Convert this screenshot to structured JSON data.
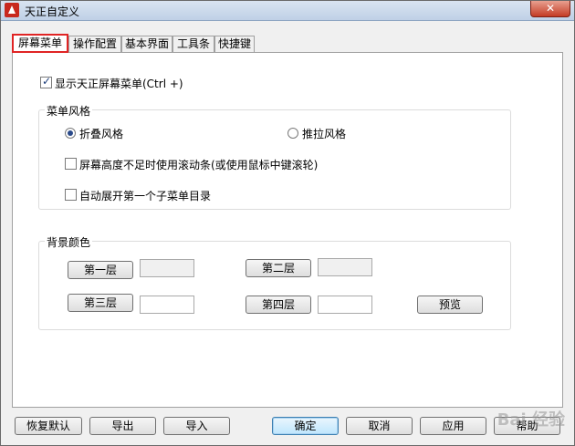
{
  "window": {
    "title": "天正自定义",
    "close_label": "✕"
  },
  "tabs": [
    {
      "label": "屏幕菜单",
      "active": true
    },
    {
      "label": "操作配置",
      "active": false
    },
    {
      "label": "基本界面",
      "active": false
    },
    {
      "label": "工具条",
      "active": false
    },
    {
      "label": "快捷键",
      "active": false
    }
  ],
  "show_menu": {
    "label": "显示天正屏幕菜单(Ctrl +)",
    "checked": true
  },
  "menu_style": {
    "title": "菜单风格",
    "options": [
      {
        "label": "折叠风格",
        "selected": true
      },
      {
        "label": "推拉风格",
        "selected": false
      }
    ],
    "scroll": {
      "label": "屏幕高度不足时使用滚动条(或使用鼠标中键滚轮)",
      "checked": false
    },
    "expand": {
      "label": "自动展开第一个子菜单目录",
      "checked": false
    }
  },
  "bg_color": {
    "title": "背景颜色",
    "layers": [
      {
        "label": "第一层",
        "color": "#f0f0f0"
      },
      {
        "label": "第二层",
        "color": "#f0f0f0"
      },
      {
        "label": "第三层",
        "color": "#ffffff"
      },
      {
        "label": "第四层",
        "color": "#ffffff"
      }
    ],
    "preview_label": "预览"
  },
  "footer": {
    "restore": "恢复默认",
    "export": "导出",
    "import": "导入",
    "ok": "确定",
    "cancel": "取消",
    "apply": "应用",
    "help": "帮助"
  },
  "watermark": "Bai 经验"
}
